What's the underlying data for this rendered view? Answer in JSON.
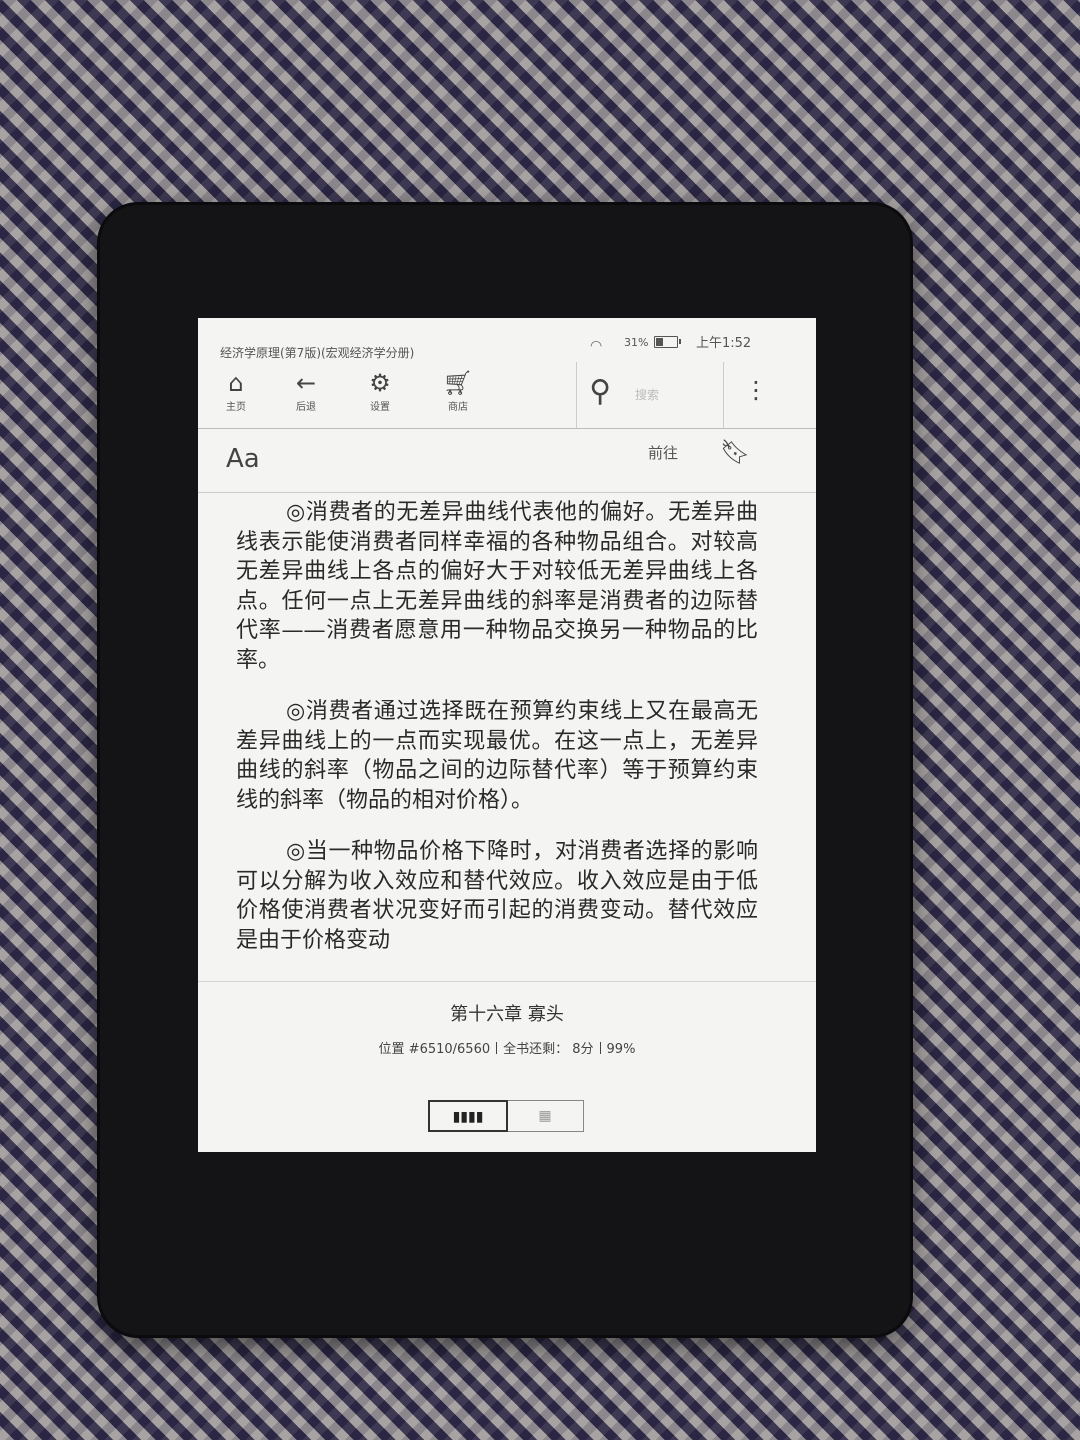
{
  "status": {
    "book_title": "经济学原理(第7版)(宏观经济学分册)",
    "battery": "31%",
    "battery_level": 0.31,
    "time": "上午1:52"
  },
  "toolbar": {
    "home": "主页",
    "back": "后退",
    "settings": "设置",
    "store": "商店",
    "search_placeholder": "搜索"
  },
  "subbar": {
    "font_label": "Aa",
    "goto_label": "前往"
  },
  "content": {
    "paragraphs": [
      "◎消费者的无差异曲线代表他的偏好。无差异曲线表示能使消费者同样幸福的各种物品组合。对较高无差异曲线上各点的偏好大于对较低无差异曲线上各点。任何一点上无差异曲线的斜率是消费者的边际替代率——消费者愿意用一种物品交换另一种物品的比率。",
      "◎消费者通过选择既在预算约束线上又在最高无差异曲线上的一点而实现最优。在这一点上，无差异曲线的斜率（物品之间的边际替代率）等于预算约束线的斜率（物品的相对价格）。",
      "◎当一种物品价格下降时，对消费者选择的影响可以分解为收入效应和替代效应。收入效应是由于低价格使消费者状况变好而引起的消费变动。替代效应是由于价格变动"
    ]
  },
  "footer": {
    "chapter": "第十六章 寡头",
    "location": "位置 #6510/6560",
    "time_left": "全书还剩： 8分",
    "percent": "99%"
  },
  "view_toggle": {
    "list_icon": "▮▮▮▮",
    "grid_icon": "▦"
  }
}
